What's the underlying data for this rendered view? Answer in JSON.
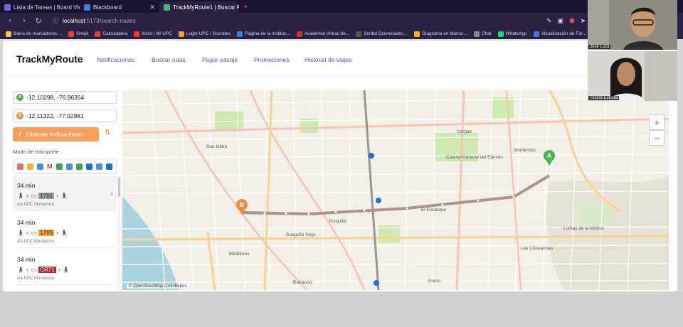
{
  "browser": {
    "tabs": [
      {
        "label": "Lista de Tareas | Board View",
        "color": "#6c63ff",
        "active": false
      },
      {
        "label": "Blackboard",
        "color": "#3b7dd8",
        "active": false
      },
      {
        "label": "TrackMyRoute1 | Buscar Rutas",
        "color": "#41b883",
        "active": true
      }
    ],
    "tab_close": "✕",
    "new_tab": "+",
    "url_host": "localhost",
    "url_path": ":5173/search-routes",
    "nav_icons": [
      "back-icon",
      "forward-icon",
      "reload-icon"
    ],
    "bookmarks": [
      {
        "label": "Barra de marcadores ...",
        "color": "#f4c542"
      },
      {
        "label": "Gmail",
        "color": "#ea4335"
      },
      {
        "label": "Calculadora",
        "color": "#e53935"
      },
      {
        "label": "Inicio | Mi UPC",
        "color": "#e53935"
      },
      {
        "label": "Login UPC / Socrates",
        "color": "#f0a030"
      },
      {
        "label": "Página de la instituc...",
        "color": "#3b7dd8"
      },
      {
        "label": "Academia Virtual de...",
        "color": "#c0392b"
      },
      {
        "label": "Scribd Downloader,...",
        "color": "#555555"
      },
      {
        "label": "Diagrama en blanco...",
        "color": "#f7b500"
      },
      {
        "label": "Chat",
        "color": "#888888"
      },
      {
        "label": "WhatsApp",
        "color": "#25d366"
      },
      {
        "label": "Visualización de Fór...",
        "color": "#4a7bd0"
      }
    ]
  },
  "app": {
    "logo": "TrackMyRoute",
    "nav": [
      "Notificaciones",
      "Buscar rutas",
      "Pagar pasaje",
      "Promociones",
      "Historial de viajes"
    ]
  },
  "search": {
    "origin": "-12.10298, -76.96354",
    "origin_marker": "A",
    "destination": "-12.11322, -77.02981",
    "destination_marker": "B",
    "directions_button": "Obtener indicaciones",
    "transport_label": "Modo de transporte"
  },
  "results": [
    {
      "duration": "34 min",
      "line": "1701",
      "via": "vía UPC Monterrico",
      "badge_color": "#9e9e9e"
    },
    {
      "duration": "34 min",
      "line": "1705",
      "via": "vía UPC Monterrico",
      "badge_color": "#f5a623"
    },
    {
      "duration": "34 min",
      "line": "CR71",
      "via": "vía UPC Monterrico",
      "badge_color": "#b42a2a"
    }
  ],
  "map": {
    "labels": [
      "San Isidro",
      "Monterrico",
      "Surquillo",
      "Miraflores",
      "Barranco",
      "Surco",
      "Las Casuarinas",
      "Surquillo Viejo",
      "El Estanque",
      "Corpac",
      "Cuartel General del Ejército",
      "Lomas de la Molina"
    ],
    "attribution": "© OpenStreetMap contributors",
    "marker_a": "A",
    "marker_b": "B",
    "zoom_in": "+",
    "zoom_out": "−"
  },
  "participants": [
    {
      "name": "Jose Luza"
    },
    {
      "name": "Ticona Estrella"
    }
  ]
}
